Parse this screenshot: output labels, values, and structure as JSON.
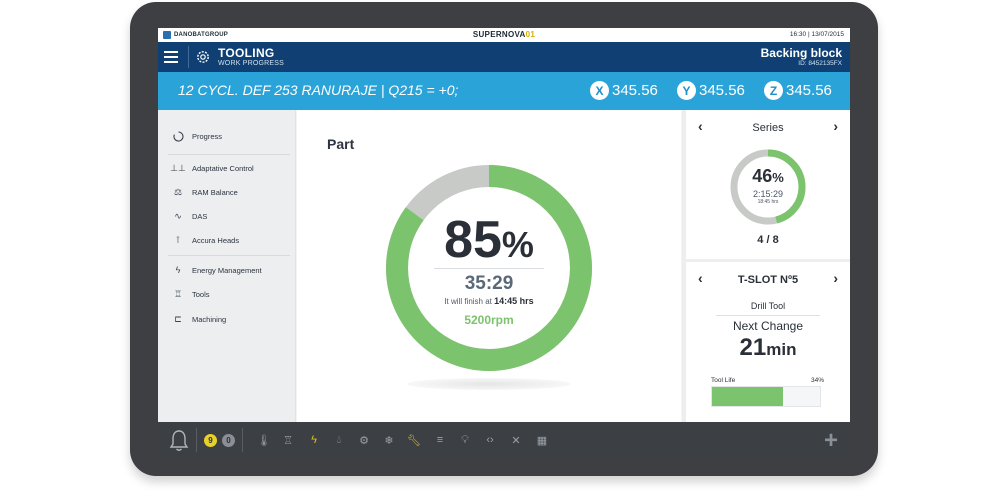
{
  "status_bar": {
    "brand": "DANOBATGROUP",
    "app_name_main": "SUPERNOVA",
    "app_name_accent": "01",
    "clock": "16:30 | 13/07/2015"
  },
  "header": {
    "title": "TOOLING",
    "subtitle": "WORK PROGRESS",
    "part_name": "Backing block",
    "part_id": "ID: 8452135FX"
  },
  "command_bar": {
    "program_line": "12 CYCL. DEF 253 RANURAJE | Q215 = +0;",
    "axes": [
      {
        "axis": "X",
        "value": "345.56"
      },
      {
        "axis": "Y",
        "value": "345.56"
      },
      {
        "axis": "Z",
        "value": "345.56"
      }
    ]
  },
  "sidebar": {
    "items": [
      {
        "label": "Progress",
        "icon": "progress-icon"
      },
      {
        "label": "Adaptative Control",
        "icon": "adaptive-control-icon"
      },
      {
        "label": "RAM Balance",
        "icon": "ram-balance-icon"
      },
      {
        "label": "DAS",
        "icon": "das-icon"
      },
      {
        "label": "Accura Heads",
        "icon": "accura-heads-icon"
      },
      {
        "label": "Energy Management",
        "icon": "energy-icon"
      },
      {
        "label": "Tools",
        "icon": "tools-icon"
      },
      {
        "label": "Machining",
        "icon": "machining-icon"
      }
    ]
  },
  "main": {
    "title": "Part",
    "progress_value": "85",
    "progress_unit": "%",
    "progress_fraction": 0.85,
    "elapsed": "35:29",
    "finish_prefix": "It will finish at",
    "finish_time": "14:45 hrs",
    "rpm": "5200rpm"
  },
  "series_card": {
    "title": "Series",
    "progress_value": "46",
    "progress_unit": "%",
    "progress_fraction": 0.46,
    "time": "2:15:29",
    "time_sub": "18:45 hrs",
    "count": "4 / 8"
  },
  "tool_card": {
    "title": "T-SLOT Nº5",
    "tool_type": "Drill Tool",
    "next_change_label": "Next Change",
    "next_change_value": "21",
    "next_change_unit": "min",
    "tool_life_label": "Tool Life",
    "tool_life_pct": "34%",
    "tool_life_fraction": 0.66
  },
  "bottom_bar": {
    "alerts_yellow": "9",
    "alerts_grey": "0"
  },
  "colors": {
    "header_bg": "#0f3f73",
    "command_bg": "#2aa3d9",
    "progress_green": "#7cc36d",
    "progress_track": "#c8cac8",
    "accent_yellow": "#e0c21a"
  }
}
